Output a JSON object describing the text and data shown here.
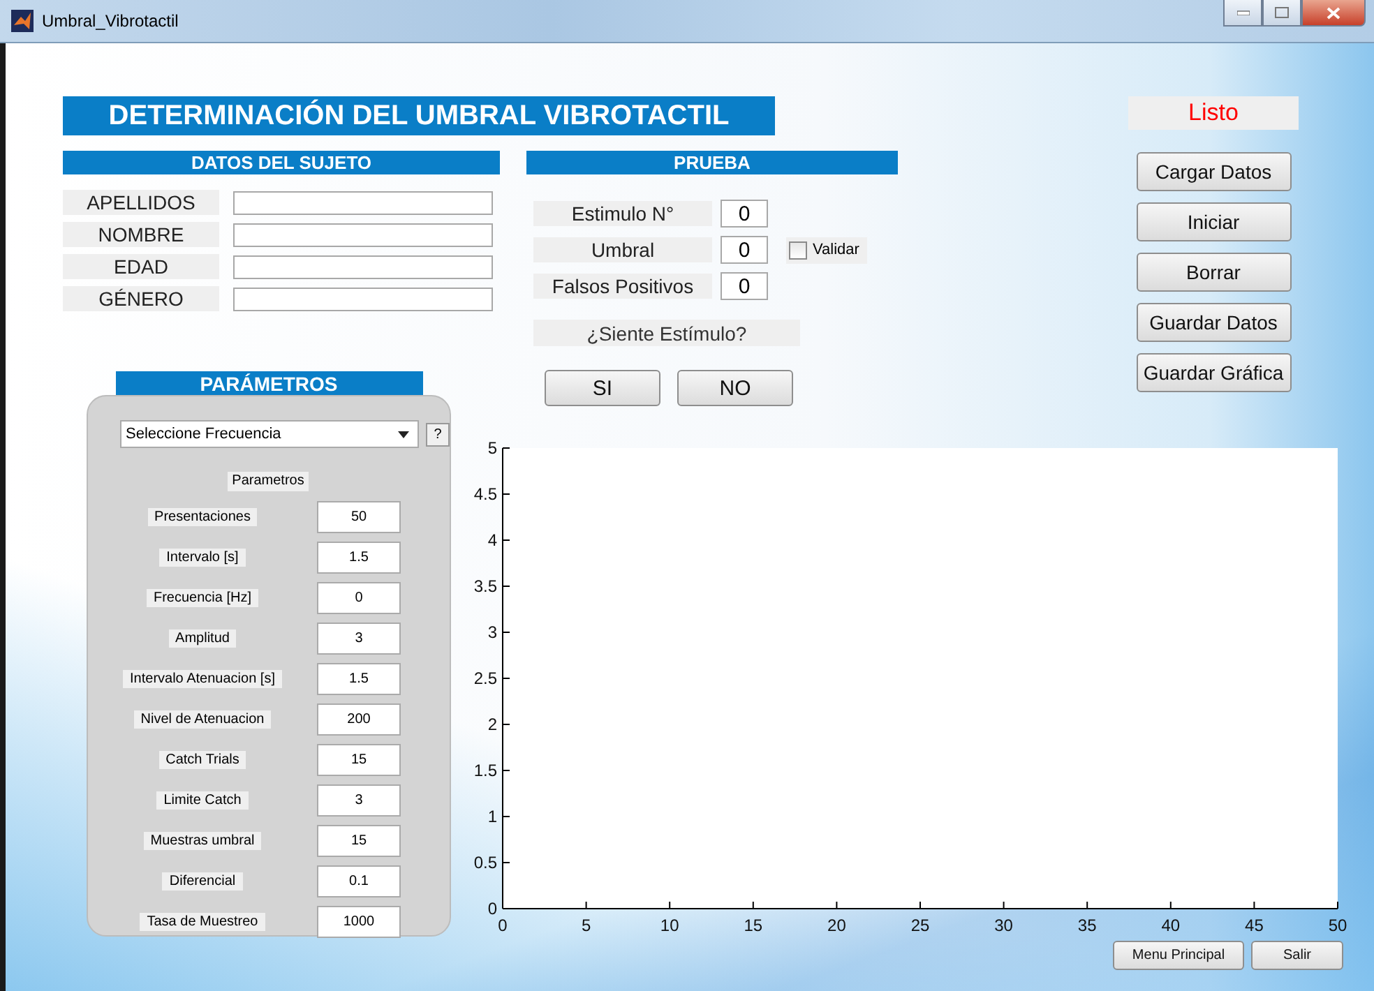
{
  "window": {
    "title": "Umbral_Vibrotactil"
  },
  "heading": "DETERMINACIÓN DEL UMBRAL VIBROTACTIL",
  "status": "Listo",
  "subject": {
    "title": "DATOS DEL SUJETO",
    "fields": [
      {
        "label": "APELLIDOS"
      },
      {
        "label": "NOMBRE"
      },
      {
        "label": "EDAD"
      },
      {
        "label": "GÉNERO"
      }
    ]
  },
  "test": {
    "title": "PRUEBA",
    "fields": [
      {
        "label": "Estimulo N°",
        "value": "0"
      },
      {
        "label": "Umbral",
        "value": "0",
        "checkbox": {
          "label": "Validar",
          "checked": false
        }
      },
      {
        "label": "Falsos Positivos",
        "value": "0"
      }
    ],
    "question": "¿Siente Estímulo?",
    "buttons": [
      "SI",
      "NO"
    ]
  },
  "parameters": {
    "title": "PARÁMETROS",
    "dropdown": "Seleccione Frecuencia",
    "help": "?",
    "subtitle": "Parametros",
    "rows": [
      {
        "label": "Presentaciones",
        "value": "50"
      },
      {
        "label": "Intervalo [s]",
        "value": "1.5"
      },
      {
        "label": "Frecuencia [Hz]",
        "value": "0"
      },
      {
        "label": "Amplitud",
        "value": "3"
      },
      {
        "label": "Intervalo Atenuacion [s]",
        "value": "1.5"
      },
      {
        "label": "Nivel de Atenuacion",
        "value": "200"
      },
      {
        "label": "Catch Trials",
        "value": "15"
      },
      {
        "label": "Limite Catch",
        "value": "3"
      },
      {
        "label": "Muestras umbral",
        "value": "15"
      },
      {
        "label": "Diferencial",
        "value": "0.1"
      },
      {
        "label": "Tasa de Muestreo",
        "value": "1000"
      }
    ]
  },
  "actions": [
    "Cargar Datos",
    "Iniciar",
    "Borrar",
    "Guardar Datos",
    "Guardar Gráfica"
  ],
  "chart": {
    "chart_data": {
      "type": "line",
      "xlim": [
        0,
        50
      ],
      "ylim": [
        0,
        5
      ],
      "xticks": [
        0,
        5,
        10,
        15,
        20,
        25,
        30,
        35,
        40,
        45,
        50
      ],
      "yticks": [
        0,
        0.5,
        1,
        1.5,
        2,
        2.5,
        3,
        3.5,
        4,
        4.5,
        5
      ]
    }
  },
  "footer_buttons": [
    "Menu Principal",
    "Salir"
  ]
}
